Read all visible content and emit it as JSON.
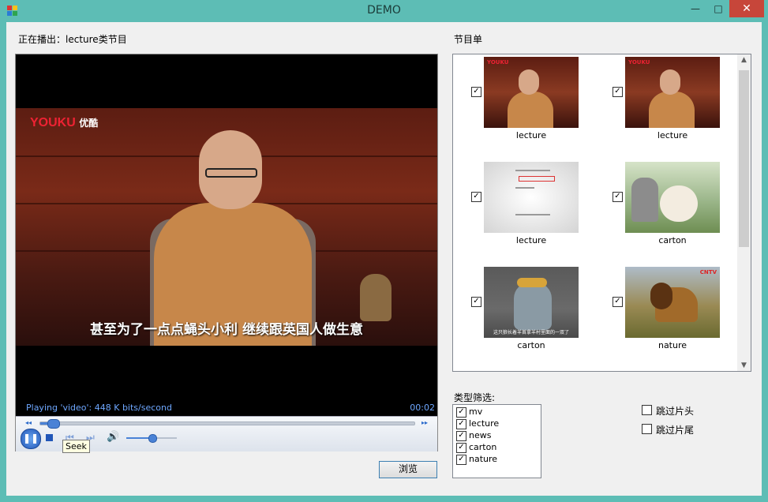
{
  "window": {
    "title": "DEMO",
    "min_glyph": "—",
    "max_glyph": "□",
    "close_glyph": "✕",
    "accent_color": "#5dbdb5",
    "close_color": "#c7463a"
  },
  "now_playing": {
    "prefix": "正在播出：",
    "value": "lecture类节目"
  },
  "playlist_label": "节目单",
  "player": {
    "logo": "YOUKU",
    "logo_cn": "优酷",
    "subtitle": "甚至为了一点点蝇头小利  继续跟英国人做生意",
    "status": "Playing 'video': 448 K bits/second",
    "time": "00:02",
    "seek_progress": 0.02,
    "volume_level": 0.5,
    "play_glyph": "❚❚",
    "prev_glyph": "⏮",
    "next_glyph": "⏭",
    "volume_glyph": "🔊",
    "seek_back_glyph": "◂◂",
    "seek_fwd_glyph": "▸▸",
    "tooltip": "Seek"
  },
  "browse_button": "浏览",
  "playlist": [
    {
      "label": "lecture",
      "checked": true,
      "thumb": "lecture"
    },
    {
      "label": "lecture",
      "checked": true,
      "thumb": "lecture"
    },
    {
      "label": "lecture",
      "checked": true,
      "thumb": "white"
    },
    {
      "label": "carton",
      "checked": true,
      "thumb": "carton1"
    },
    {
      "label": "carton",
      "checked": true,
      "thumb": "carton2"
    },
    {
      "label": "nature",
      "checked": true,
      "thumb": "nature"
    }
  ],
  "thumb_text": {
    "lecture_logo": "YOUKU",
    "carton2_sub": "这只狼长着羊首拿羊村里面的一双了",
    "nature_tag": "CNTV"
  },
  "scroll": {
    "up_glyph": "▲",
    "down_glyph": "▼"
  },
  "filter": {
    "label": "类型筛选:",
    "items": [
      {
        "label": "mv",
        "checked": true
      },
      {
        "label": "lecture",
        "checked": true
      },
      {
        "label": "news",
        "checked": true
      },
      {
        "label": "carton",
        "checked": true
      },
      {
        "label": "nature",
        "checked": true
      }
    ]
  },
  "options": {
    "skip_intro": {
      "label": "跳过片头",
      "checked": false
    },
    "skip_outro": {
      "label": "跳过片尾",
      "checked": false
    }
  },
  "check_glyph": "✓"
}
